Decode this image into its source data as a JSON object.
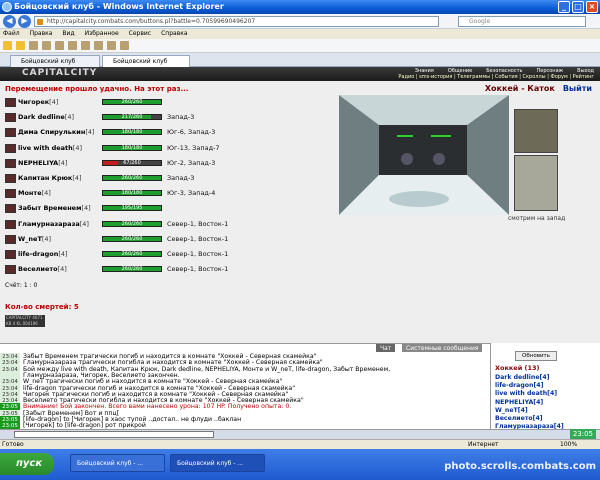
{
  "window": {
    "title": "Бойцовский клуб - Windows Internet Explorer"
  },
  "address": {
    "url": "http://capitalcity.combats.com/buttons.pl?battle=0.70599690496207",
    "search_placeholder": "Google"
  },
  "menu": [
    "Файл",
    "Правка",
    "Вид",
    "Избранное",
    "Сервис",
    "Справка"
  ],
  "tabs": [
    {
      "label": "Бойцовский клуб"
    },
    {
      "label": "Бойцовский клуб"
    }
  ],
  "header": {
    "logo": "CAPITALCITY",
    "nav_top": [
      "Знания",
      "Общение",
      "Безопасность",
      "Персонаж",
      "Выход"
    ],
    "nav_bottom": "Радио | sms-история | Телеграммы | События | Скроллы | Форум | Рейтинг"
  },
  "game": {
    "message": "Перемещение прошло удачно. На этот раз...",
    "room_title": "Хоккей - Каток",
    "exit_label": "Выйти",
    "caption": "смотрим на запад",
    "score": "Счёт: 1 : 0",
    "deaths": "Кол-во смертей: 5",
    "badge": "CAPITALCITY 4071 KB 4 KL 004196",
    "players": [
      {
        "name": "Чигорек",
        "lvl": "[4]",
        "hp": "260/260",
        "pct": 1.0,
        "loc": ""
      },
      {
        "name": "Dark dedline",
        "lvl": "[4]",
        "hp": "217/260",
        "pct": 0.835,
        "loc": "Запад-3"
      },
      {
        "name": "Дима Спирулькин",
        "lvl": "[4]",
        "hp": "180/180",
        "pct": 1.0,
        "loc": "Юг-6, Запад-3"
      },
      {
        "name": "live with death",
        "lvl": "[4]",
        "hp": "180/180",
        "pct": 1.0,
        "loc": "Юг-13, Запад-7"
      },
      {
        "name": "NEPHELIYA",
        "lvl": "[4]",
        "hp": "67/260",
        "pct": 0.26,
        "loc": "Юг-2, Запад-3"
      },
      {
        "name": "Капитан Крюк",
        "lvl": "[4]",
        "hp": "260/260",
        "pct": 1.0,
        "loc": "Запад-3"
      },
      {
        "name": "Монте",
        "lvl": "[4]",
        "hp": "180/180",
        "pct": 1.0,
        "loc": "Юг-3, Запад-4"
      },
      {
        "name": "Забыт Временем",
        "lvl": "[4]",
        "hp": "195/195",
        "pct": 1.0,
        "loc": ""
      },
      {
        "name": "Гламурназараза",
        "lvl": "[4]",
        "hp": "260/260",
        "pct": 1.0,
        "loc": "Север-1, Восток-1"
      },
      {
        "name": "W_neT",
        "lvl": "[4]",
        "hp": "260/260",
        "pct": 1.0,
        "loc": "Север-1, Восток-1"
      },
      {
        "name": "life-dragon",
        "lvl": "[4]",
        "hp": "260/260",
        "pct": 1.0,
        "loc": "Север-1, Восток-1"
      },
      {
        "name": "Веселието",
        "lvl": "[4]",
        "hp": "260/260",
        "pct": 1.0,
        "loc": "Север-1, Восток-1"
      }
    ]
  },
  "chat": {
    "tab_chat": "Чат",
    "tab_sys": "Системные сообщения",
    "lines": [
      {
        "t": "23:04",
        "text": "Забыт Временем трагически погиб и находится в комнате \"Хоккей - Северная скамейка\"",
        "g": false
      },
      {
        "t": "23:04",
        "text": "Гламурназараза трагически погибла и находится в комнате \"Хоккей - Северная скамейка\"",
        "g": false
      },
      {
        "t": "23:04",
        "text": "Бой между live with death, Капитан Крюк, Dark dedline, NEPHELIYA, Монте и W_neT, life-dragon, Забыт Временем,",
        "g": false
      },
      {
        "t": "",
        "text": "Гламурназараза, Чигорек, Веселието закончен.",
        "g": false
      },
      {
        "t": "23:04",
        "text": "W_neT трагически погиб и находится в комнате \"Хоккей - Северная скамейка\"",
        "g": false
      },
      {
        "t": "23:04",
        "text": "life-dragon трагически погиб и находится в комнате \"Хоккей - Северная скамейка\"",
        "g": false
      },
      {
        "t": "23:04",
        "text": "Чигорек трагически погиб и находится в комнате \"Хоккей - Северная скамейка\"",
        "g": false
      },
      {
        "t": "23:04",
        "text": "Веселието трагически погибла и находится в комнате \"Хоккей - Северная скамейка\"",
        "g": false
      },
      {
        "t": "23:05",
        "text": "Внимание! Бой закончен. Всего вами нанесено урона: 107 HP. Получено опыта: 0.",
        "g": true
      },
      {
        "t": "23:05",
        "text": "[Забыт Временем] Вот и ппц[",
        "g": false
      },
      {
        "t": "23:05",
        "text": "[life-dragon] to [Чигорек] в хаос тупой ..достал.. не флуди ..баклан",
        "g": true
      },
      {
        "t": "23:05",
        "text": "[Чигорек] to [life-dragon] рот прикрой",
        "g": true
      }
    ]
  },
  "users": {
    "refresh": "Обновить",
    "header": "Хоккей (13)",
    "list": [
      "Dark dedline[4]",
      "life-dragon[4]",
      "live with death[4]",
      "NEPHELIYA[4]",
      "W_neT[4]",
      "Веселието[4]",
      "Гламурназараза[4]"
    ]
  },
  "clock": "23:05",
  "statusbar": {
    "left": "Готово",
    "internet": "Интернет",
    "zoom": "100%"
  },
  "taskbar": {
    "start": "пуск",
    "tasks": [
      "Бойцовский клуб - ...",
      "Бойцовский клуб - ..."
    ],
    "watermark": "photo.scrolls.combats.com"
  }
}
